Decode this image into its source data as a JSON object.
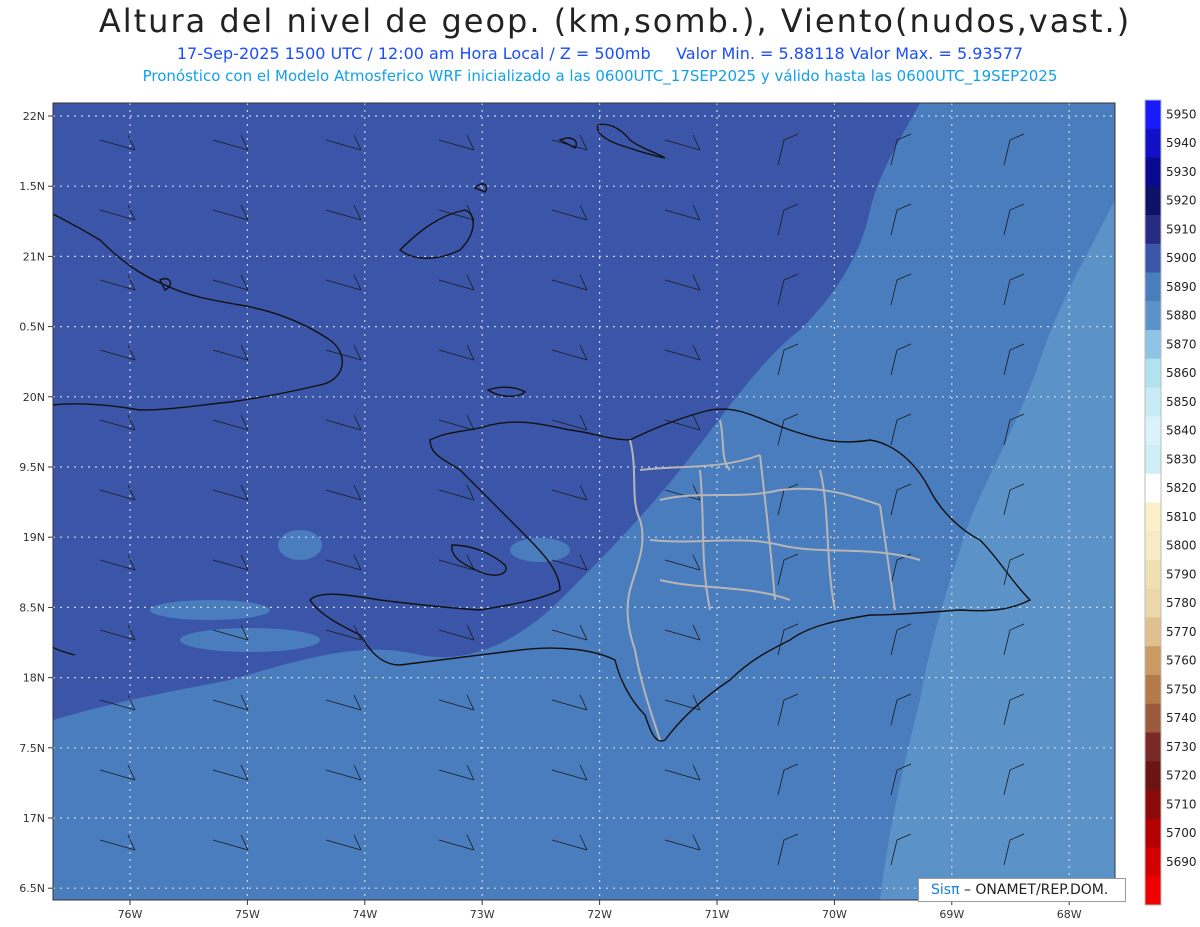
{
  "header": {
    "title": "Altura del nivel de geop. (km,somb.), Viento(nudos,vast.)",
    "subtitle_left": "17-Sep-2025  1500 UTC / 12:00 am Hora Local / Z = 500mb",
    "subtitle_right": "Valor Min. = 5.88118  Valor Max. = 5.93577",
    "info": "Pronóstico con el Modelo Atmosferico WRF inicializado a las 0600UTC_17SEP2025 y válido hasta las  0600UTC_19SEP2025"
  },
  "map": {
    "lat_ticks": [
      "22N",
      "1.5N",
      "21N",
      "0.5N",
      "20N",
      "9.5N",
      "19N",
      "8.5N",
      "18N",
      "7.5N",
      "17N",
      "6.5N"
    ],
    "lon_ticks": [
      "76W",
      "75W",
      "74W",
      "73W",
      "72W",
      "71W",
      "70W",
      "69W",
      "68W"
    ],
    "region_colors": {
      "dark": "#3b56a8",
      "medium": "#4a7dbd",
      "light": "#5b93c9",
      "coast": "#111111",
      "borders": "#b5b5b5"
    }
  },
  "colorbar": {
    "labels": [
      "5950",
      "5940",
      "5930",
      "5920",
      "5910",
      "5900",
      "5890",
      "5880",
      "5870",
      "5860",
      "5850",
      "5840",
      "5830",
      "5820",
      "5810",
      "5800",
      "5790",
      "5780",
      "5770",
      "5760",
      "5750",
      "5740",
      "5730",
      "5720",
      "5710",
      "5700",
      "5690"
    ],
    "colors": [
      "#1a1aff",
      "#1010c8",
      "#0a0a90",
      "#0d1266",
      "#262a80",
      "#3b56a8",
      "#4a7dbd",
      "#5b93c9",
      "#8fc4e4",
      "#b3e2ef",
      "#c8ecf5",
      "#daf2fa",
      "#cdeff5",
      "#ffffff",
      "#fbf0c8",
      "#f6ebc6",
      "#efe0b4",
      "#ead8aa",
      "#dfc08e",
      "#c99a62",
      "#b57a4a",
      "#9c5a3c",
      "#7a2a26",
      "#6b1414",
      "#8a0a0a",
      "#b30000",
      "#d40000",
      "#ee0000"
    ]
  },
  "credit": {
    "brand": "Sisπ",
    "text": "– ONAMET/REP.DOM."
  }
}
